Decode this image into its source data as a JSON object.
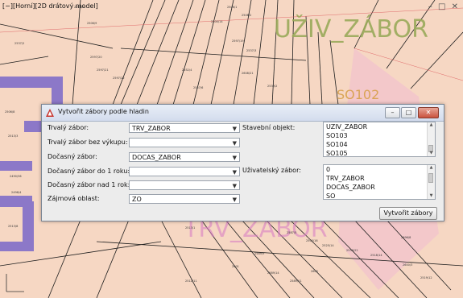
{
  "viewport": {
    "label": "[−][Horní][2D drátový model]",
    "map_text_large_1": "UŽIV_ZÁBOR",
    "map_text_large_2": "TRV_ZÁBOR",
    "map_text_so": "SO102",
    "parcels": [
      "2506/1",
      "2506/2",
      "2500/14",
      "2597/17",
      "2506/9",
      "2597/19",
      "2537/3",
      "2552/4",
      "2557/6",
      "2539/2",
      "2608/21",
      "2597/20",
      "2597/21",
      "2597/22",
      "2537/2",
      "2506/8",
      "2513/3",
      "2490/36",
      "2496/4",
      "2513/8",
      "2513/1",
      "2587/5",
      "2505/16",
      "2525/14",
      "2539/22",
      "2518/14",
      "2589/9",
      "2589/14",
      "2589/11",
      "2601",
      "2605",
      "2600/3",
      "2696/8",
      "2519/12",
      "2512/11"
    ],
    "colors": {
      "background": "#f6d7c3",
      "parcel_line": "#1e1e1e",
      "purple": "#8c78c8",
      "pink_zone": "#f3c4cc",
      "text_green": "#9aaa5a"
    }
  },
  "dialog": {
    "title": "Vytvořit zábory podle hladin",
    "fields": [
      {
        "label": "Trvalý zábor:",
        "value": "TRV_ZABOR"
      },
      {
        "label": "Trvalý zábor bez výkupu:",
        "value": ""
      },
      {
        "label": "Dočasný zábor:",
        "value": "DOCAS_ZABOR"
      },
      {
        "label": "Dočasný zábor do 1 roku:",
        "value": ""
      },
      {
        "label": "Dočasný zábor nad 1 rok:",
        "value": ""
      },
      {
        "label": "Zájmová oblast:",
        "value": "ZO"
      }
    ],
    "stavebni_objekt": {
      "label": "Stavební objekt:",
      "items": [
        "UZIV_ZABOR",
        "SO103",
        "SO104",
        "SO105"
      ]
    },
    "uzivatelsky_zabor": {
      "label": "Uživatelský zábor:",
      "items": [
        "0",
        "TRV_ZABOR",
        "DOCAS_ZABOR",
        "SO"
      ]
    },
    "submit_label": "Vytvořit zábory",
    "window_buttons": {
      "minimize": "–",
      "maximize": "□",
      "close": "✕"
    }
  }
}
